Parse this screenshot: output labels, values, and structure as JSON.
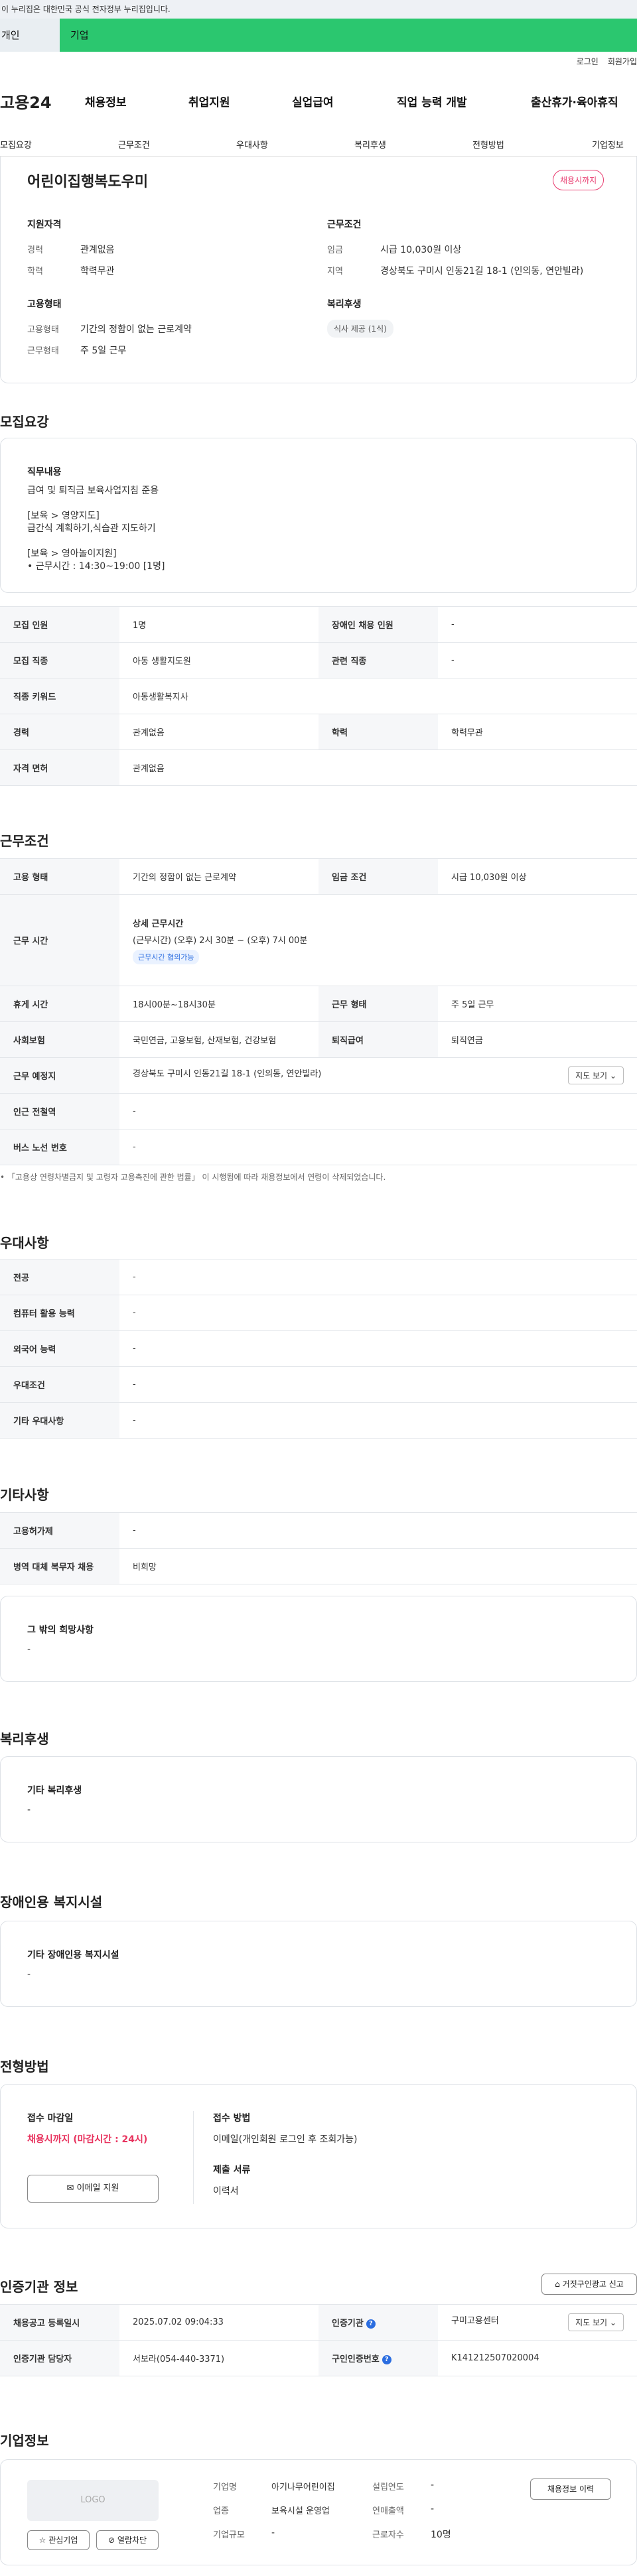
{
  "gov_banner": "이 누리집은 대한민국 공식 전자정부 누리집입니다.",
  "user_tabs": [
    "개인",
    "기업"
  ],
  "top_links": [
    "로그인",
    "회원가입"
  ],
  "logo": "고용24",
  "gnb": [
    "채용정보",
    "취업지원",
    "실업급여",
    "직업 능력 개발",
    "출산휴가·육아휴직"
  ],
  "tabs": [
    "모집요강",
    "근무조건",
    "우대사항",
    "복리후생",
    "전형방법",
    "기업정보"
  ],
  "summary": {
    "title": "어린이집행복도우미",
    "badge": "채용시까지",
    "qual_h": "지원자격",
    "exp_l": "경력",
    "exp_v": "관계없음",
    "edu_l": "학력",
    "edu_v": "학력무관",
    "emp_h": "고용형태",
    "emptype_l": "고용형태",
    "emptype_v": "기간의 정함이 없는 근로계약",
    "worktype_l": "근무형태",
    "worktype_v": "주 5일 근무",
    "cond_h": "근무조건",
    "wage_l": "임금",
    "wage_v": "시급 10,030원 이상",
    "area_l": "지역",
    "area_v": "경상북도 구미시 인동21길 18-1 (인의동, 연안빌라)",
    "welfare_h": "복리후생",
    "welfare_chip": "식사 제공 (1식)"
  },
  "recruit": {
    "title": "모집요강",
    "duty_h": "직무내용",
    "duty_lines": [
      "급여 및 퇴직금 보육사업지침 준용",
      "",
      "[보육 > 영양지도]",
      "급간식 계획하기,식습관 지도하기",
      "",
      "[보육 > 영아놀이지원]",
      "• 근무시간 : 14:30~19:00 [1명]"
    ],
    "rows": [
      [
        "모집 인원",
        "1명",
        "장애인 채용 인원",
        "-"
      ],
      [
        "모집 직종",
        "아동 생활지도원",
        "관련 직종",
        "-"
      ]
    ],
    "keyword_k": "직종 키워드",
    "keyword_v": "아동생활복지사",
    "career_k": "경력",
    "career_v": "관계없음",
    "edu_k": "학력",
    "edu_v": "학력무관",
    "license_k": "자격 면허",
    "license_v": "관계없음"
  },
  "cond": {
    "title": "근무조건",
    "emp_k": "고용 형태",
    "emp_v": "기간의 정함이 없는 근로계약",
    "wage_k": "임금 조건",
    "wage_v": "시급 10,030원 이상",
    "time_k": "근무 시간",
    "time_h": "상세 근무시간",
    "time_v": "(근무시간) (오후) 2시 30분 ~ (오후) 7시 00분",
    "time_tag": "근무시간 협의가능",
    "rest_k": "휴게 시간",
    "rest_v": "18시00분~18시30분",
    "form_k": "근무 형태",
    "form_v": "주 5일 근무",
    "ins_k": "사회보험",
    "ins_v": "국민연금, 고용보험, 산재보험, 건강보험",
    "ret_k": "퇴직급여",
    "ret_v": "퇴직연금",
    "place_k": "근무 예정지",
    "place_v": "경상북도 구미시 인동21길 18-1 (인의동, 연안빌라)",
    "map": "지도 보기",
    "station_k": "인근 전철역",
    "station_v": "-",
    "bus_k": "버스 노선 번호",
    "bus_v": "-",
    "note": "• 「고용상 연령차별금지 및 고령자 고용촉진에 관한 법률」 이 시행됨에 따라 채용정보에서 연령이 삭제되었습니다."
  },
  "pref": {
    "title": "우대사항",
    "rows": [
      [
        "전공",
        "-"
      ],
      [
        "컴퓨터 활용 능력",
        "-"
      ],
      [
        "외국어 능력",
        "-"
      ],
      [
        "우대조건",
        "-"
      ],
      [
        "기타 우대사항",
        "-"
      ]
    ]
  },
  "etc": {
    "title": "기타사항",
    "rows": [
      [
        "고용허가제",
        "-"
      ],
      [
        "병역 대체 복무자 채용",
        "비희망"
      ]
    ],
    "hope_h": "그 밖의 희망사항",
    "hope_v": "-"
  },
  "welfare": {
    "title": "복리후생",
    "h": "기타 복리후생",
    "v": "-"
  },
  "disabled": {
    "title": "장애인용 복지시설",
    "h": "기타 장애인용 복지시설",
    "v": "-"
  },
  "process": {
    "title": "전형방법",
    "deadline_h": "접수 마감일",
    "deadline_v": "채용시까지 (마감시간 : 24시)",
    "email_btn": "이메일 지원",
    "method_h": "접수 방법",
    "method_v": "이메일(개인회원 로그인 후 조회가능)",
    "docs_h": "제출 서류",
    "docs_v": "이력서"
  },
  "agency": {
    "title": "인증기관 정보",
    "report": "거짓구인광고 신고",
    "reg_k": "채용공고 등록일시",
    "reg_v": "2025.07.02 09:04:33",
    "org_k": "인증기관",
    "org_v": "구미고용센터",
    "map": "지도 보기",
    "mgr_k": "인증기관 담당자",
    "mgr_v": "서보라(054-440-3371)",
    "no_k": "구인인증번호",
    "no_v": "K141212507020004"
  },
  "company": {
    "title": "기업정보",
    "logo": "LOGO",
    "interest": "관심기업",
    "follow": "열람차단",
    "name_k": "기업명",
    "name_v": "아기나무어린이집",
    "year_k": "설립연도",
    "year_v": "-",
    "ind_k": "업종",
    "ind_v": "보육시설 운영업",
    "sales_k": "연매출액",
    "sales_v": "-",
    "size_k": "기업규모",
    "size_v": "-",
    "emp_k": "근로자수",
    "emp_v": "10명",
    "history": "채용정보 이력"
  }
}
